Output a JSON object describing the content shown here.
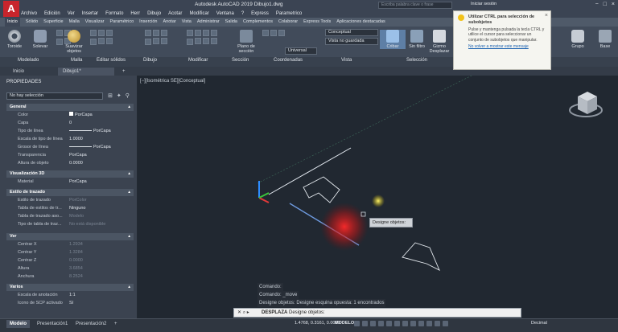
{
  "app": {
    "logo": "A",
    "title": "Autodesk AutoCAD 2019   Dibujo1.dwg"
  },
  "menu": [
    "Archivo",
    "Edición",
    "Ver",
    "Insertar",
    "Formato",
    "Herr",
    "Dibujo",
    "Acotar",
    "Modificar",
    "Ventana",
    "?",
    "Express",
    "Parametrico"
  ],
  "search": {
    "placeholder": "Escriba palabra clave o frase"
  },
  "signin": "Iniciar sesión",
  "ribbon_tabs": [
    "Inicio",
    "Sólido",
    "Superficie",
    "Malla",
    "Visualizar",
    "Paramétrico",
    "Inserción",
    "Anotar",
    "Vista",
    "Administrar",
    "Salida",
    "Complementos",
    "Colaborar",
    "Express Tools",
    "Aplicaciones destacadas"
  ],
  "ribbon_buttons": {
    "toroide": "Toroide",
    "solevar": "Solevar",
    "suavizar": "Suavizar objetos",
    "plano": "Plano de sección",
    "cribar": "Cribar",
    "sin_filtro": "Sin filtro",
    "gizmo": "Gizmo Desplazar",
    "grupo": "Grupo",
    "base": "Base"
  },
  "ribbon_dropdowns": {
    "visual_style": "Conceptual",
    "view": "Vista no guardada",
    "ucs": "Universal"
  },
  "panels": [
    "Modelado",
    "Malla",
    "Editar sólidos",
    "Dibujo",
    "Modificar",
    "Sección",
    "Coordenadas",
    "Vista",
    "Selección"
  ],
  "file_tabs": {
    "start": "Inicio",
    "drawing": "Dibujo1*"
  },
  "tooltip": {
    "title": "Utilizar CTRL para selección de subobjetos",
    "body": "Pulse y mantenga pulsada la tecla CTRL y utilice el cursor para seleccionar un conjunto de subobjetos que manipular.",
    "link": "No volver a mostrar este mensaje"
  },
  "properties": {
    "title": "PROPIEDADES",
    "selection": "No hay selección",
    "sections": {
      "general": "General",
      "viz3d": "Visualización 3D",
      "plotstyle": "Estilo de trazado",
      "view": "Ver",
      "misc": "Varios"
    },
    "general": [
      {
        "label": "Color",
        "value": "PorCapa"
      },
      {
        "label": "Capa",
        "value": "0"
      },
      {
        "label": "Tipo de línea",
        "value": "PorCapa"
      },
      {
        "label": "Escala de tipo de línea",
        "value": "1.0000"
      },
      {
        "label": "Grosor de línea",
        "value": "PorCapa"
      },
      {
        "label": "Transparencia",
        "value": "PorCapa"
      },
      {
        "label": "Altura de objeto",
        "value": "0.0000"
      }
    ],
    "viz3d": [
      {
        "label": "Material",
        "value": "PorCapa"
      }
    ],
    "plotstyle": [
      {
        "label": "Estilo de trazado",
        "value": "PorColor"
      },
      {
        "label": "Tabla de estilos de tr...",
        "value": "Ninguno"
      },
      {
        "label": "Tabla de trazado aso...",
        "value": "Modelo"
      },
      {
        "label": "Tipo de tabla de traz...",
        "value": "No está disponible"
      }
    ],
    "view": [
      {
        "label": "Centrar X",
        "value": "1.2934"
      },
      {
        "label": "Centrar Y",
        "value": "1.3284"
      },
      {
        "label": "Centrar Z",
        "value": "0.0000"
      },
      {
        "label": "Altura",
        "value": "3.6854"
      },
      {
        "label": "Anchura",
        "value": "8.2524"
      }
    ],
    "misc": [
      {
        "label": "Escala de anotación",
        "value": "1:1"
      },
      {
        "label": "Icono de SCP activado",
        "value": "Sí"
      }
    ]
  },
  "viewport": {
    "label": "[−][Isométrica SE][Conceptual]"
  },
  "cursor_tooltip": "Designe objetos:",
  "command_history": [
    "Comando:",
    "Comando: _move",
    "Designe objetos: Designe esquina opuesta: 1 encontrados"
  ],
  "command_line": {
    "name": "DESPLAZA",
    "prompt": "Designe objetos:"
  },
  "status": {
    "tabs": [
      "Modelo",
      "Presentación1",
      "Presentación2"
    ],
    "coords": "1.4768, 0.3161, 0.0000",
    "model": "MODELO",
    "units": "Decimal"
  },
  "colors": {
    "accent": "#c8252c",
    "title_bar": "#3b4453",
    "viewport": "#212831",
    "panel": "#3b4350"
  }
}
